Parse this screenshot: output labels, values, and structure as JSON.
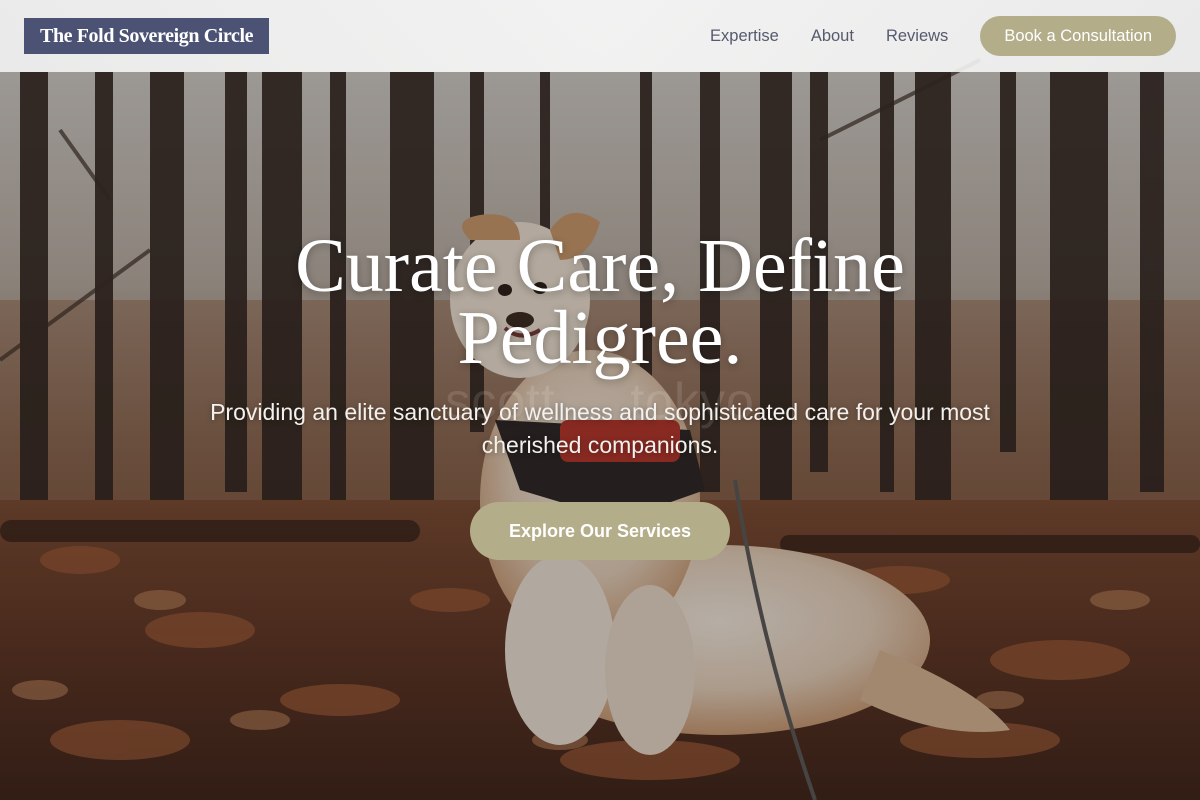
{
  "header": {
    "logo": "The Fold Sovereign Circle",
    "nav": [
      {
        "label": "Expertise"
      },
      {
        "label": "About"
      },
      {
        "label": "Reviews"
      }
    ],
    "cta_label": "Book a Consultation"
  },
  "hero": {
    "title": "Curate Care, Define Pedigree.",
    "subtitle": "Providing an elite sanctuary of wellness and sophisticated care for your most cherished companions.",
    "cta_label": "Explore Our Services",
    "watermark": "scott  ...  tokyo",
    "image_description_icon": "dog-in-autumn-forest-photo"
  },
  "colors": {
    "logo_bg": "#4c5274",
    "accent": "#b3ad8a",
    "nav_text": "#565a6e",
    "header_bg": "#f0f0f0"
  }
}
